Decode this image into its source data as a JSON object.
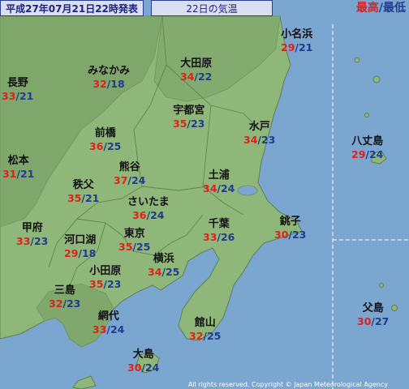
{
  "header": {
    "issued": "平成27年07月21日22時発表",
    "title": "22日の気温",
    "legend_high": "最高",
    "legend_sep": "/",
    "legend_low": "最低"
  },
  "colors": {
    "high": "#e0201b",
    "low": "#1f3c8f",
    "sea": "#7aa6d0",
    "land": "#8fb77a"
  },
  "stations": [
    {
      "id": "oginohama",
      "name": "小名浜",
      "high": "29",
      "low": "21"
    },
    {
      "id": "nagano",
      "name": "長野",
      "high": "33",
      "low": "21"
    },
    {
      "id": "minakami",
      "name": "みなかみ",
      "high": "32",
      "low": "18"
    },
    {
      "id": "otawara",
      "name": "大田原",
      "high": "34",
      "low": "22"
    },
    {
      "id": "utsunomiya",
      "name": "宇都宮",
      "high": "35",
      "low": "23"
    },
    {
      "id": "maebashi",
      "name": "前橋",
      "high": "36",
      "low": "25"
    },
    {
      "id": "mito",
      "name": "水戸",
      "high": "34",
      "low": "23"
    },
    {
      "id": "hachijojima",
      "name": "八丈島",
      "high": "29",
      "low": "24"
    },
    {
      "id": "matsumoto",
      "name": "松本",
      "high": "31",
      "low": "21"
    },
    {
      "id": "kumagaya",
      "name": "熊谷",
      "high": "37",
      "low": "24"
    },
    {
      "id": "chichibu",
      "name": "秩父",
      "high": "35",
      "low": "21"
    },
    {
      "id": "tsuchiura",
      "name": "土浦",
      "high": "34",
      "low": "24"
    },
    {
      "id": "saitama",
      "name": "さいたま",
      "high": "36",
      "low": "24"
    },
    {
      "id": "kofu",
      "name": "甲府",
      "high": "33",
      "low": "23"
    },
    {
      "id": "kawaguchiko",
      "name": "河口湖",
      "high": "29",
      "low": "18"
    },
    {
      "id": "tokyo",
      "name": "東京",
      "high": "35",
      "low": "25"
    },
    {
      "id": "chiba",
      "name": "千葉",
      "high": "33",
      "low": "26"
    },
    {
      "id": "choshi",
      "name": "銚子",
      "high": "30",
      "low": "23"
    },
    {
      "id": "odawara",
      "name": "小田原",
      "high": "35",
      "low": "23"
    },
    {
      "id": "yokohama",
      "name": "横浜",
      "high": "34",
      "low": "25"
    },
    {
      "id": "mishima",
      "name": "三島",
      "high": "32",
      "low": "23"
    },
    {
      "id": "ajiro",
      "name": "網代",
      "high": "33",
      "low": "24"
    },
    {
      "id": "tateyama",
      "name": "館山",
      "high": "32",
      "low": "25"
    },
    {
      "id": "chichijima",
      "name": "父島",
      "high": "30",
      "low": "27"
    },
    {
      "id": "oshima",
      "name": "大島",
      "high": "30",
      "low": "24"
    }
  ],
  "copyright": "All rights reserved. Copyright © Japan Meteorological Agency"
}
